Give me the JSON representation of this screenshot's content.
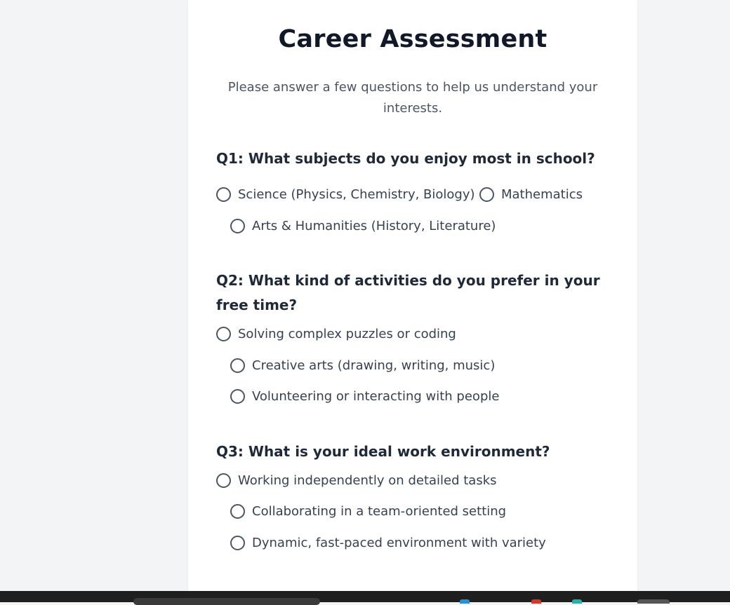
{
  "page": {
    "title": "Career Assessment",
    "subtitle": "Please answer a few questions to help us understand your interests."
  },
  "questions": [
    {
      "label": "Q1: What subjects do you enjoy most in school?",
      "options": [
        "Science (Physics, Chemistry, Biology)",
        "Mathematics",
        "Arts & Humanities (History, Literature)"
      ]
    },
    {
      "label": "Q2: What kind of activities do you prefer in your free time?",
      "options": [
        "Solving complex puzzles or coding",
        "Creative arts (drawing, writing, music)",
        "Volunteering or interacting with people"
      ]
    },
    {
      "label": "Q3: What is your ideal work environment?",
      "options": [
        "Working independently on detailed tasks",
        "Collaborating in a team-oriented setting",
        "Dynamic, fast-paced environment with variety"
      ]
    }
  ],
  "colors": {
    "background": "#f3f4f6",
    "card": "#ffffff",
    "title": "#111827",
    "text": "#374151",
    "taskbar": "#1f1f1f"
  }
}
